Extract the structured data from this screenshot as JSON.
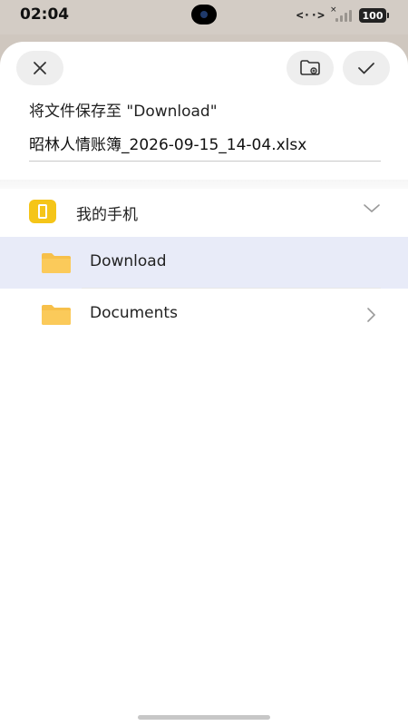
{
  "status_bar": {
    "time": "02:04",
    "data_indicator": "<··>",
    "battery": "100"
  },
  "header": {
    "close_icon": "close-icon",
    "new_folder_icon": "folder-add-icon",
    "confirm_icon": "check-icon"
  },
  "dialog": {
    "title": "将文件保存至 \"Download\"",
    "filename": "昭林人情账簿_2026-09-15_14-04.xlsx"
  },
  "location": {
    "device_label": "我的手机",
    "folders": [
      {
        "label": "Download",
        "selected": true
      },
      {
        "label": "Documents",
        "selected": false
      }
    ]
  },
  "colors": {
    "selected_row": "#e8ebf8",
    "folder_yellow": "#f7c04a",
    "device_icon": "#f5c518"
  }
}
